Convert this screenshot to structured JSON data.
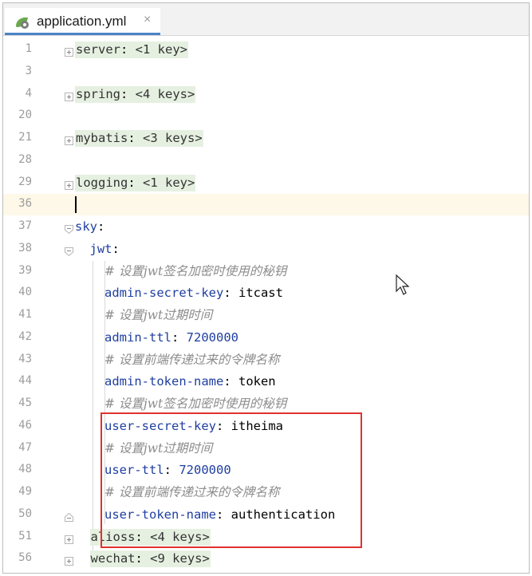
{
  "tab": {
    "filename": "application.yml",
    "close_glyph": "×",
    "icon": "spring-yaml-icon"
  },
  "lines": [
    {
      "num": "1",
      "fold": "collapsed",
      "indent": 0,
      "kind": "folded",
      "key": "server",
      "summary": "<1 key>"
    },
    {
      "num": "3",
      "kind": "blank"
    },
    {
      "num": "4",
      "fold": "collapsed",
      "indent": 0,
      "kind": "folded",
      "key": "spring",
      "summary": "<4 keys>"
    },
    {
      "num": "20",
      "kind": "blank"
    },
    {
      "num": "21",
      "fold": "collapsed",
      "indent": 0,
      "kind": "folded",
      "key": "mybatis",
      "summary": "<3 keys>"
    },
    {
      "num": "28",
      "kind": "blank"
    },
    {
      "num": "29",
      "fold": "collapsed",
      "indent": 0,
      "kind": "folded",
      "key": "logging",
      "summary": "<1 key>"
    },
    {
      "num": "36",
      "kind": "caret",
      "current": true
    },
    {
      "num": "37",
      "fold": "open",
      "indent": 0,
      "kind": "key",
      "key": "sky"
    },
    {
      "num": "38",
      "fold": "open",
      "indent": 1,
      "kind": "key",
      "key": "jwt"
    },
    {
      "num": "39",
      "indent": 2,
      "kind": "comment",
      "text": "# 设置jwt签名加密时使用的秘钥"
    },
    {
      "num": "40",
      "indent": 2,
      "kind": "pair",
      "key": "admin-secret-key",
      "value": "itcast"
    },
    {
      "num": "41",
      "indent": 2,
      "kind": "comment",
      "text": "# 设置jwt过期时间"
    },
    {
      "num": "42",
      "indent": 2,
      "kind": "pair",
      "key": "admin-ttl",
      "value": "7200000",
      "numeric": true
    },
    {
      "num": "43",
      "indent": 2,
      "kind": "comment",
      "text": "# 设置前端传递过来的令牌名称"
    },
    {
      "num": "44",
      "indent": 2,
      "kind": "pair",
      "key": "admin-token-name",
      "value": "token"
    },
    {
      "num": "45",
      "indent": 2,
      "kind": "comment",
      "text": "# 设置jwt签名加密时使用的秘钥"
    },
    {
      "num": "46",
      "indent": 2,
      "kind": "pair",
      "key": "user-secret-key",
      "value": "itheima"
    },
    {
      "num": "47",
      "indent": 2,
      "kind": "comment",
      "text": "# 设置jwt过期时间"
    },
    {
      "num": "48",
      "indent": 2,
      "kind": "pair",
      "key": "user-ttl",
      "value": "7200000",
      "numeric": true
    },
    {
      "num": "49",
      "indent": 2,
      "kind": "comment",
      "text": "# 设置前端传递过来的令牌名称"
    },
    {
      "num": "50",
      "fold": "end",
      "indent": 2,
      "kind": "pair",
      "key": "user-token-name",
      "value": "authentication"
    },
    {
      "num": "51",
      "fold": "collapsed",
      "indent": 1,
      "kind": "folded",
      "key": "alioss",
      "summary": "<4 keys>"
    },
    {
      "num": "56",
      "fold": "collapsed",
      "indent": 1,
      "kind": "folded",
      "key": "wechat",
      "summary": "<9 keys>"
    }
  ],
  "colors": {
    "accent_tab": "#4a83c6",
    "highlight_box": "#e0322f",
    "key": "#1f3fa0",
    "comment": "#8c8c8c"
  }
}
